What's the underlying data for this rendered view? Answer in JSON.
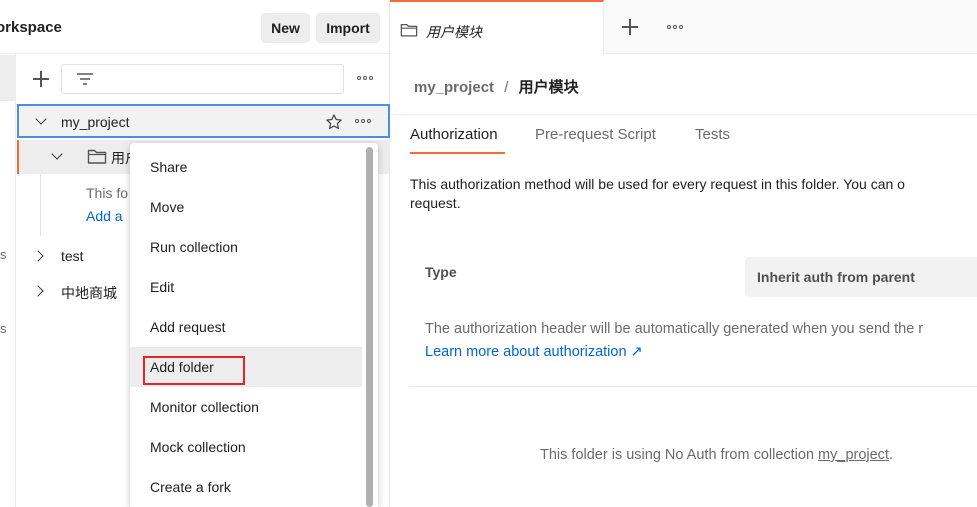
{
  "workspace": {
    "title": "orkspace",
    "new_label": "New",
    "import_label": "Import"
  },
  "sidebar": {
    "rail_letters": [
      "s",
      "s"
    ],
    "tree": {
      "project": "my_project",
      "folder": "用户模块",
      "folder_truncated": "用户",
      "empty_text": "This fo",
      "add_link": "Add a",
      "collections": [
        "test",
        "中地商城"
      ]
    }
  },
  "context_menu": {
    "items": [
      "Share",
      "Move",
      "Run collection",
      "Edit",
      "Add request",
      "Add folder",
      "Monitor collection",
      "Mock collection",
      "Create a fork"
    ],
    "highlighted": "Add folder"
  },
  "tabs": {
    "active_label": "用户模块"
  },
  "breadcrumb": {
    "project": "my_project",
    "separator": "/",
    "current": "用户模块"
  },
  "sub_tabs": [
    "Authorization",
    "Pre-request Script",
    "Tests"
  ],
  "authorization": {
    "description_line1": "This authorization method will be used for every request in this folder. You can o",
    "description_line2": "request.",
    "type_label": "Type",
    "type_value": "Inherit auth from parent",
    "note": "The authorization header will be automatically generated when you send the r",
    "learn_more": "Learn more about authorization ↗",
    "folder_note_prefix": "This folder is using No Auth from collection ",
    "folder_note_link": "my_project",
    "folder_note_suffix": "."
  },
  "colors": {
    "accent": "#f26b3a",
    "link": "#0265d2",
    "selection_border": "#4a90e2",
    "highlight_box": "#e0262b"
  }
}
